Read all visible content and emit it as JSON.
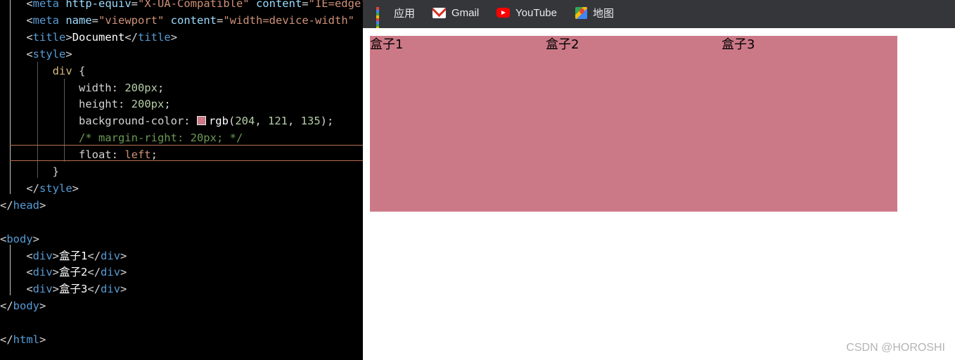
{
  "editor": {
    "lines": [
      {
        "segs": [
          [
            "punc",
            "    <"
          ],
          [
            "tag",
            "meta"
          ],
          [
            "attr",
            " http-equiv"
          ],
          [
            "punc",
            "="
          ],
          [
            "str",
            "\"X-UA-Compatible\""
          ],
          [
            "attr",
            " content"
          ],
          [
            "punc",
            "="
          ],
          [
            "str",
            "\"IE=edge\""
          ]
        ]
      },
      {
        "segs": [
          [
            "punc",
            "    <"
          ],
          [
            "tag",
            "meta"
          ],
          [
            "attr",
            " name"
          ],
          [
            "punc",
            "="
          ],
          [
            "str",
            "\"viewport\""
          ],
          [
            "attr",
            " content"
          ],
          [
            "punc",
            "="
          ],
          [
            "str",
            "\"width=device-width\""
          ]
        ]
      },
      {
        "segs": [
          [
            "punc",
            "    <"
          ],
          [
            "tag",
            "title"
          ],
          [
            "punc",
            ">"
          ],
          [
            "txt",
            "Document"
          ],
          [
            "punc",
            "</"
          ],
          [
            "tag",
            "title"
          ],
          [
            "punc",
            ">"
          ]
        ]
      },
      {
        "segs": [
          [
            "punc",
            "    <"
          ],
          [
            "tag",
            "style"
          ],
          [
            "punc",
            ">"
          ]
        ]
      },
      {
        "segs": [
          [
            "sel",
            "        div"
          ],
          [
            "punc",
            " {"
          ]
        ]
      },
      {
        "segs": [
          [
            "prop",
            "            width"
          ],
          [
            "punc",
            ": "
          ],
          [
            "num",
            "200px"
          ],
          [
            "punc",
            ";"
          ]
        ]
      },
      {
        "segs": [
          [
            "prop",
            "            height"
          ],
          [
            "punc",
            ": "
          ],
          [
            "num",
            "200px"
          ],
          [
            "punc",
            ";"
          ]
        ]
      },
      {
        "segs": [
          [
            "prop",
            "            background-color"
          ],
          [
            "punc",
            ": "
          ],
          [
            "swatch",
            ""
          ],
          [
            "txt",
            "rgb"
          ],
          [
            "punc",
            "("
          ],
          [
            "num",
            "204"
          ],
          [
            "punc",
            ", "
          ],
          [
            "num",
            "121"
          ],
          [
            "punc",
            ", "
          ],
          [
            "num",
            "135"
          ],
          [
            "punc",
            ");"
          ]
        ]
      },
      {
        "segs": [
          [
            "cmt",
            "            /* margin-right: 20px; */"
          ]
        ]
      },
      {
        "segs": [
          [
            "prop",
            "            float"
          ],
          [
            "punc",
            ": "
          ],
          [
            "val",
            "left"
          ],
          [
            "punc",
            ";"
          ]
        ]
      },
      {
        "segs": [
          [
            "punc",
            "        }"
          ]
        ]
      },
      {
        "segs": [
          [
            "punc",
            "    </"
          ],
          [
            "tag",
            "style"
          ],
          [
            "punc",
            ">"
          ]
        ]
      },
      {
        "segs": [
          [
            "punc",
            "</"
          ],
          [
            "tag",
            "head"
          ],
          [
            "punc",
            ">"
          ]
        ]
      },
      {
        "segs": []
      },
      {
        "segs": [
          [
            "punc",
            "<"
          ],
          [
            "tag",
            "body"
          ],
          [
            "punc",
            ">"
          ]
        ]
      },
      {
        "segs": [
          [
            "punc",
            "    <"
          ],
          [
            "tag",
            "div"
          ],
          [
            "punc",
            ">"
          ],
          [
            "txt",
            "盒子1"
          ],
          [
            "punc",
            "</"
          ],
          [
            "tag",
            "div"
          ],
          [
            "punc",
            ">"
          ]
        ]
      },
      {
        "segs": [
          [
            "punc",
            "    <"
          ],
          [
            "tag",
            "div"
          ],
          [
            "punc",
            ">"
          ],
          [
            "txt",
            "盒子2"
          ],
          [
            "punc",
            "</"
          ],
          [
            "tag",
            "div"
          ],
          [
            "punc",
            ">"
          ]
        ]
      },
      {
        "segs": [
          [
            "punc",
            "    <"
          ],
          [
            "tag",
            "div"
          ],
          [
            "punc",
            ">"
          ],
          [
            "txt",
            "盒子3"
          ],
          [
            "punc",
            "</"
          ],
          [
            "tag",
            "div"
          ],
          [
            "punc",
            ">"
          ]
        ]
      },
      {
        "segs": [
          [
            "punc",
            "</"
          ],
          [
            "tag",
            "body"
          ],
          [
            "punc",
            ">"
          ]
        ]
      },
      {
        "segs": []
      },
      {
        "segs": [
          [
            "punc",
            "</"
          ],
          [
            "tag",
            "html"
          ],
          [
            "punc",
            ">"
          ]
        ]
      }
    ]
  },
  "bookmarks": [
    {
      "label": "应用",
      "icon": "apps-icon"
    },
    {
      "label": "Gmail",
      "icon": "gmail-icon"
    },
    {
      "label": "YouTube",
      "icon": "youtube-icon"
    },
    {
      "label": "地图",
      "icon": "maps-icon"
    }
  ],
  "page": {
    "boxes": [
      "盒子1",
      "盒子2",
      "盒子3"
    ],
    "box_color": "#cc7987"
  },
  "watermark": "CSDN @HOROSHI"
}
